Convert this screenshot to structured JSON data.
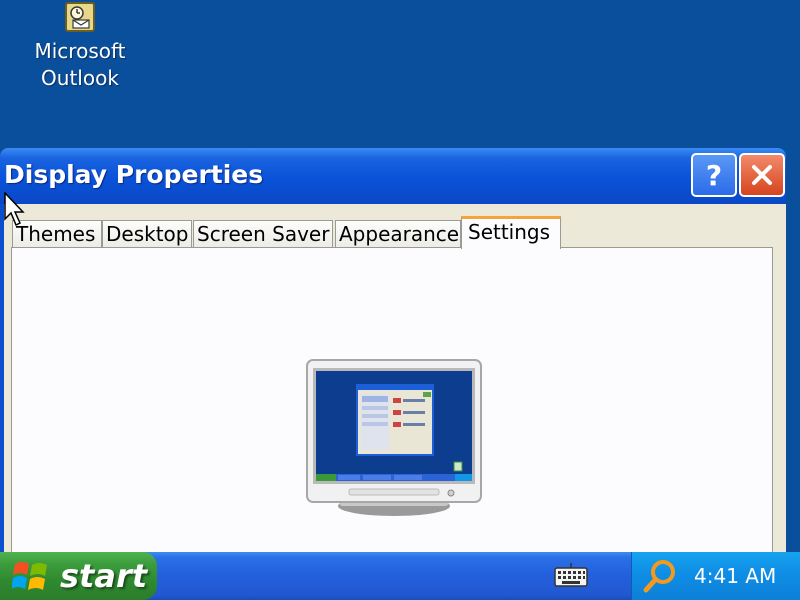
{
  "desktop": {
    "icons": [
      {
        "label_line1": "Microsoft",
        "label_line2": "Outlook",
        "icon": "outlook-icon"
      }
    ]
  },
  "window": {
    "title": "Display Properties",
    "help_button": "?",
    "close_button_icon": "close-icon",
    "tabs": [
      {
        "label": "Themes",
        "active": false
      },
      {
        "label": "Desktop",
        "active": false
      },
      {
        "label": "Screen Saver",
        "active": false
      },
      {
        "label": "Appearance",
        "active": false
      },
      {
        "label": "Settings",
        "active": true
      }
    ],
    "preview_icon": "monitor-preview-icon"
  },
  "taskbar": {
    "start_label": "start",
    "tray_icons": [
      "keyboard-icon",
      "search-icon"
    ],
    "clock": "4:41 AM"
  },
  "colors": {
    "desktop": "#0a4f9c",
    "titlebar": "#0a52d8",
    "close_button": "#d7441f",
    "active_tab_accent": "#f4a43a",
    "start_button": "#3c9c3c"
  }
}
